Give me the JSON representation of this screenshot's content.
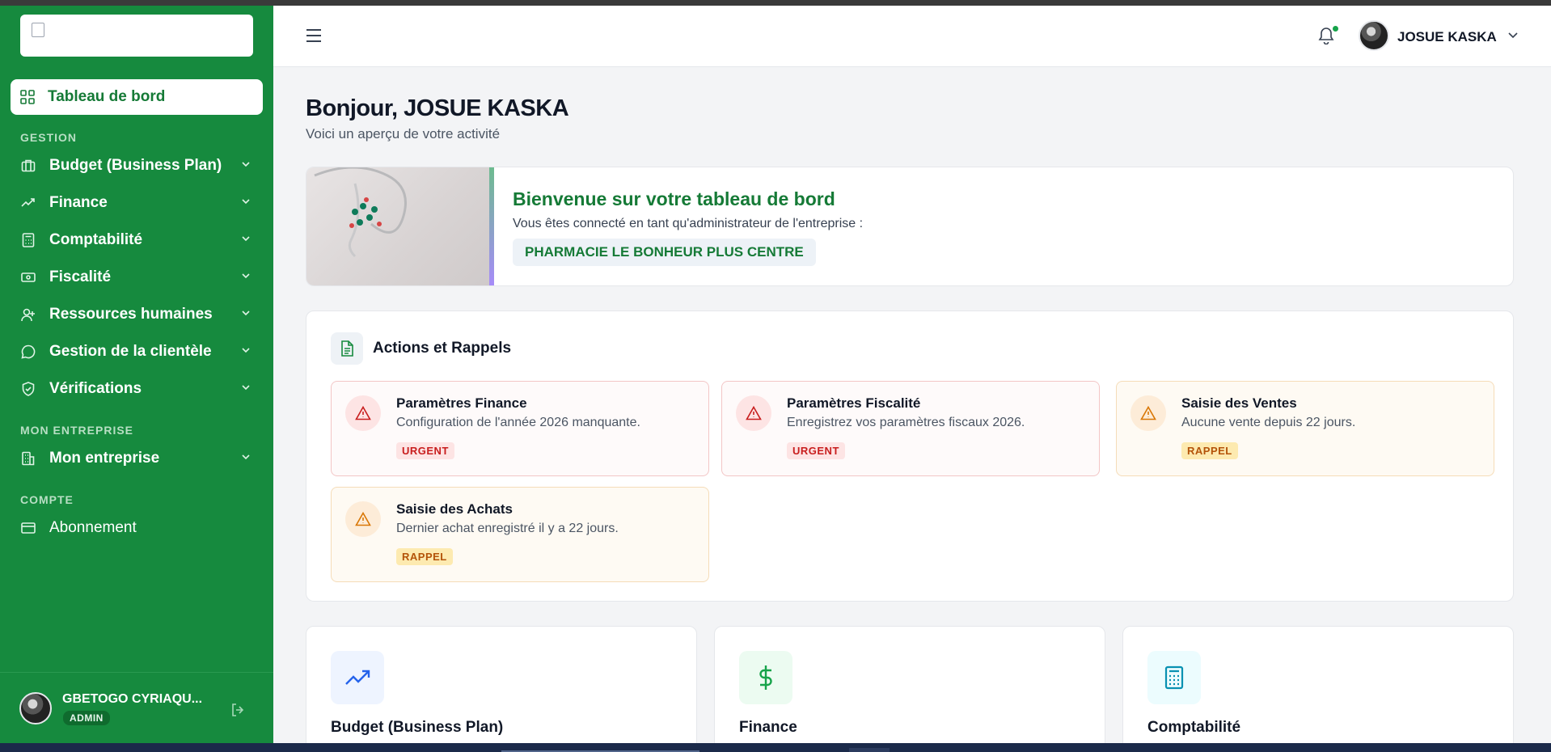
{
  "sidebar": {
    "active_item": "Tableau de bord",
    "sections": {
      "gestion": "GESTION",
      "entreprise": "MON ENTREPRISE",
      "compte": "COMPTE"
    },
    "items": [
      {
        "label": "Budget (Business Plan)",
        "icon": "briefcase-icon"
      },
      {
        "label": "Finance",
        "icon": "trending-up-icon"
      },
      {
        "label": "Comptabilité",
        "icon": "calculator-icon"
      },
      {
        "label": "Fiscalité",
        "icon": "banknote-icon"
      },
      {
        "label": "Ressources humaines",
        "icon": "user-plus-icon"
      },
      {
        "label": "Gestion de la clientèle",
        "icon": "message-circle-icon"
      },
      {
        "label": "Vérifications",
        "icon": "shield-check-icon"
      },
      {
        "label": "Mon entreprise",
        "icon": "building-icon"
      },
      {
        "label": "Abonnement",
        "icon": "credit-card-icon"
      }
    ],
    "user": {
      "name": "GBETOGO CYRIAQU...",
      "role": "ADMIN"
    }
  },
  "header": {
    "user_name": "JOSUE KASKA"
  },
  "main": {
    "greeting": "Bonjour, JOSUE KASKA",
    "subtitle": "Voici un aperçu de votre activité",
    "welcome": {
      "title": "Bienvenue sur votre tableau de bord",
      "description": "Vous êtes connecté en tant qu'administrateur de l'entreprise :",
      "company": "PHARMACIE LE BONHEUR PLUS CENTRE"
    },
    "actions": {
      "title": "Actions et Rappels",
      "cards": [
        {
          "title": "Paramètres Finance",
          "description": "Configuration de l'année 2026 manquante.",
          "badge": "URGENT"
        },
        {
          "title": "Paramètres Fiscalité",
          "description": "Enregistrez vos paramètres fiscaux 2026.",
          "badge": "URGENT"
        },
        {
          "title": "Saisie des Ventes",
          "description": "Aucune vente depuis 22 jours.",
          "badge": "RAPPEL"
        },
        {
          "title": "Saisie des Achats",
          "description": "Dernier achat enregistré il y a 22 jours.",
          "badge": "RAPPEL"
        }
      ]
    },
    "modules": [
      {
        "title": "Budget (Business Plan)",
        "icon": "trending-up-icon"
      },
      {
        "title": "Finance",
        "icon": "dollar-icon"
      },
      {
        "title": "Comptabilité",
        "icon": "calculator-icon"
      }
    ]
  },
  "colors": {
    "brand_green": "#168a3e",
    "urgent_red": "#c81e1e",
    "reminder_amber": "#b45309"
  }
}
